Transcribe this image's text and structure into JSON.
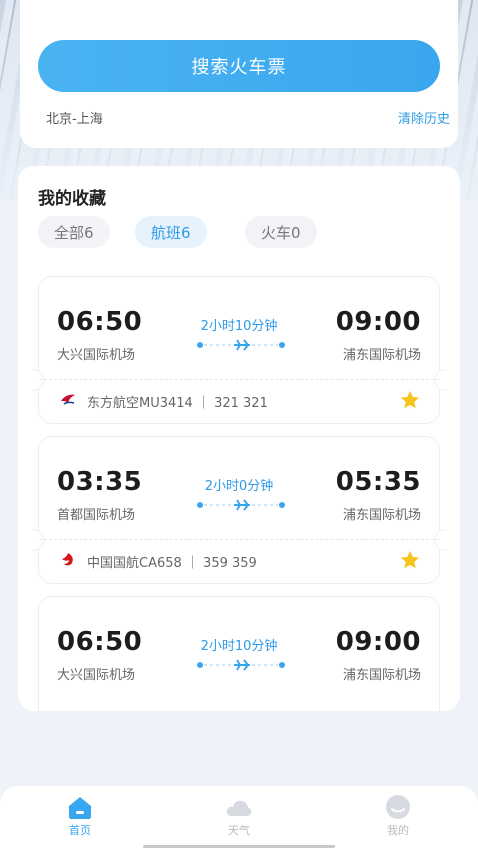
{
  "search": {
    "button_label": "搜索火车票",
    "history_item": "北京-上海",
    "clear_history_label": "清除历史"
  },
  "favorites": {
    "title": "我的收藏",
    "filters": [
      {
        "label": "全部6",
        "active": false
      },
      {
        "label": "航班6",
        "active": true
      },
      {
        "label": "火车0",
        "active": false
      }
    ],
    "flights": [
      {
        "dep_time": "06:50",
        "dep_airport": "大兴国际机场",
        "arr_time": "09:00",
        "arr_airport": "浦东国际机场",
        "duration": "2小时10分钟",
        "airline_info": "东方航空MU3414 ｜ 321 321",
        "airline_icon": "china-eastern-logo"
      },
      {
        "dep_time": "03:35",
        "dep_airport": "首都国际机场",
        "arr_time": "05:35",
        "arr_airport": "浦东国际机场",
        "duration": "2小时0分钟",
        "airline_info": "中国国航CA658 ｜ 359 359",
        "airline_icon": "air-china-logo"
      },
      {
        "dep_time": "06:50",
        "dep_airport": "大兴国际机场",
        "arr_time": "09:00",
        "arr_airport": "浦东国际机场",
        "duration": "2小时10分钟"
      }
    ]
  },
  "tabbar": {
    "items": [
      {
        "label": "首页",
        "icon": "home-icon",
        "active": true
      },
      {
        "label": "天气",
        "icon": "cloud-icon",
        "active": false
      },
      {
        "label": "我的",
        "icon": "profile-icon",
        "active": false
      }
    ]
  },
  "colors": {
    "accent": "#3aa6ef",
    "star": "#f7c21b",
    "background": "#eef3fa"
  }
}
